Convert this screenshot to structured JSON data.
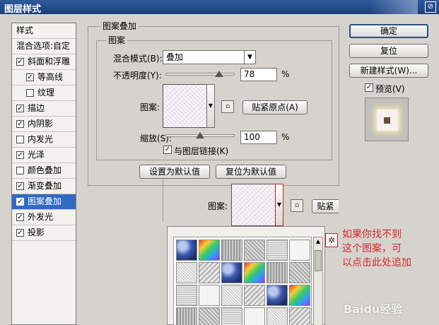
{
  "window": {
    "title": "图层样式",
    "close_glyph": "⊘"
  },
  "styles_list": {
    "header": "样式",
    "blend_options": "混合选项:自定",
    "items": [
      {
        "label": "斜面和浮雕",
        "checked": true,
        "indent": false
      },
      {
        "label": "等高线",
        "checked": true,
        "indent": true
      },
      {
        "label": "纹理",
        "checked": false,
        "indent": true
      },
      {
        "label": "描边",
        "checked": true,
        "indent": false
      },
      {
        "label": "内阴影",
        "checked": true,
        "indent": false
      },
      {
        "label": "内发光",
        "checked": false,
        "indent": false
      },
      {
        "label": "光泽",
        "checked": true,
        "indent": false
      },
      {
        "label": "颜色叠加",
        "checked": false,
        "indent": false
      },
      {
        "label": "渐变叠加",
        "checked": true,
        "indent": false
      },
      {
        "label": "图案叠加",
        "checked": true,
        "indent": false,
        "selected": true
      },
      {
        "label": "外发光",
        "checked": true,
        "indent": false
      },
      {
        "label": "投影",
        "checked": true,
        "indent": false
      }
    ]
  },
  "panel": {
    "group_title": "图案叠加",
    "sub_title": "图案",
    "blend_mode_label": "混合模式(B):",
    "blend_mode_value": "叠加",
    "opacity_label": "不透明度(Y):",
    "opacity_value": "78",
    "opacity_fraction": 0.78,
    "percent": "%",
    "pattern_label": "图案:",
    "snap_origin_button": "贴紧原点(A)",
    "scale_label": "缩放(S):",
    "scale_value": "100",
    "scale_fraction": 0.5,
    "link_layer_label": "与图层链接(K)",
    "link_layer_checked": true,
    "set_default_button": "设置为默认值",
    "reset_default_button": "复位为默认值",
    "pattern_label_2": "图案:",
    "snap_button_partial": "贴紧"
  },
  "right_buttons": {
    "ok": "确定",
    "reset": "复位",
    "new_style": "新建样式(W)...",
    "preview_label": "预览(V)",
    "preview_checked": true
  },
  "annotation": {
    "lines": [
      "如果你找不到",
      "这个图案，可",
      "以点击此处追加"
    ],
    "color": "#d9262a"
  },
  "watermark": "Baidu经验"
}
